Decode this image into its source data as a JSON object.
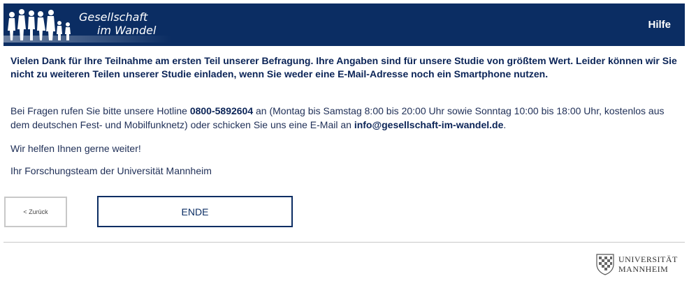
{
  "header": {
    "logo_line1": "Gesellschaft",
    "logo_line2": "im Wandel",
    "help_label": "Hilfe",
    "background_color": "#0b2d63"
  },
  "content": {
    "intro": "Vielen Dank für Ihre Teilnahme am ersten Teil unserer Befragung. Ihre Angaben sind für unsere Studie von größtem Wert. Leider können wir Sie nicht zu weiteren Teilen unserer Studie einladen, wenn Sie weder eine E-Mail-Adresse noch ein Smartphone nutzen.",
    "hotline_prefix": "Bei Fragen rufen Sie bitte unsere Hotline ",
    "hotline_number": "0800-5892604",
    "hotline_middle": " an (Montag bis Samstag 8:00 bis 20:00 Uhr sowie Sonntag 10:00 bis 18:00 Uhr, kostenlos aus dem deutschen Fest- und Mobilfunknetz) oder schicken Sie uns eine E-Mail an ",
    "email": "info@gesellschaft-im-wandel.de",
    "hotline_suffix": ".",
    "help_text": "Wir helfen Ihnen gerne weiter!",
    "signature": "Ihr Forschungsteam der Universität Mannheim"
  },
  "buttons": {
    "back_label": "< Zurück",
    "end_label": "ENDE"
  },
  "footer": {
    "uni_line1": "UNIVERSITÄT",
    "uni_line2": "MANNHEIM"
  }
}
